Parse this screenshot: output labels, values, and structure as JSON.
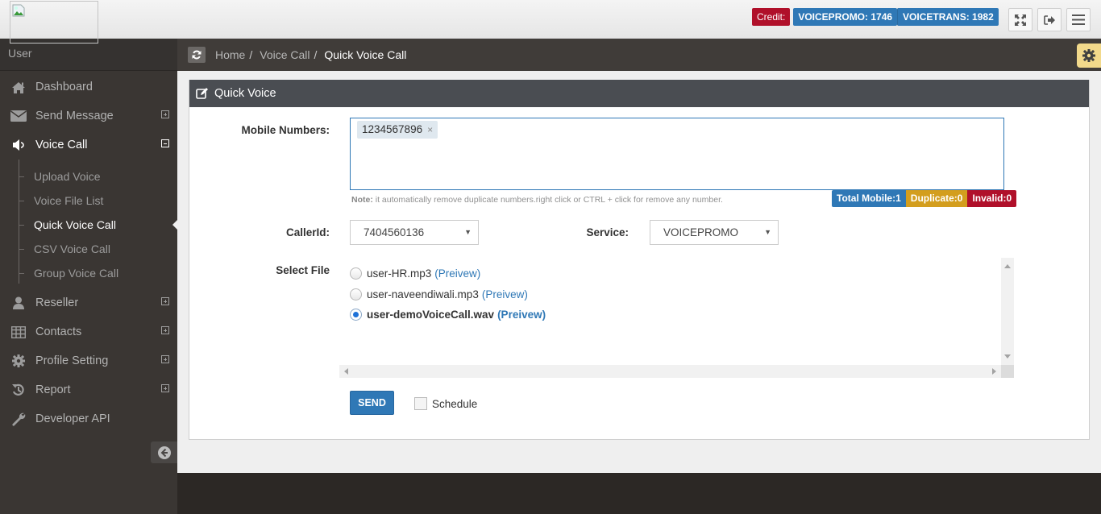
{
  "header": {
    "credit_label": "Credit:",
    "balances": [
      {
        "label": "VOICEPROMO: 1746"
      },
      {
        "label": "VOICETRANS: 1982"
      }
    ],
    "buttons": {
      "fullscreen": "fullscreen-icon",
      "logout": "logout-icon",
      "menu": "menu-icon"
    }
  },
  "sidebar": {
    "user_label": "User",
    "items": [
      {
        "label": "Dashboard",
        "icon": "home-icon"
      },
      {
        "label": "Send Message",
        "icon": "envelope-icon",
        "expand": "plus"
      },
      {
        "label": "Voice Call",
        "icon": "speaker-icon",
        "expand": "minus"
      },
      {
        "label": "Reseller",
        "icon": "user-icon",
        "expand": "plus"
      },
      {
        "label": "Contacts",
        "icon": "table-icon",
        "expand": "plus"
      },
      {
        "label": "Profile Setting",
        "icon": "gear-icon",
        "expand": "plus"
      },
      {
        "label": "Report",
        "icon": "history-icon",
        "expand": "plus"
      },
      {
        "label": "Developer API",
        "icon": "wrench-icon"
      }
    ],
    "voice_submenu": [
      {
        "label": "Upload Voice"
      },
      {
        "label": "Voice File List"
      },
      {
        "label": "Quick Voice Call"
      },
      {
        "label": "CSV Voice Call"
      },
      {
        "label": "Group Voice Call"
      }
    ]
  },
  "breadcrumb": {
    "items": [
      "Home",
      "Voice Call"
    ],
    "separator": "/",
    "current": "Quick Voice Call"
  },
  "panel": {
    "title": "Quick Voice",
    "mobile_label": "Mobile Numbers:",
    "mobile_tags": [
      "1234567896"
    ],
    "tag_remove": "×",
    "note_prefix": "Note:",
    "note_text": " it automatically remove duplicate numbers.right click or CTRL + click for remove any number.",
    "counts": {
      "total": "Total Mobile:1",
      "duplicate": "Duplicate:0",
      "invalid": "Invalid:0"
    },
    "callerid_label": "CallerId:",
    "callerid_value": "7404560136",
    "service_label": "Service:",
    "service_value": "VOICEPROMO",
    "select_file_label": "Select File",
    "files": [
      {
        "name": "user-HR.mp3",
        "preview": "(Preivew)",
        "checked": false
      },
      {
        "name": "user-naveendiwali.mp3",
        "preview": "(Preivew)",
        "checked": false
      },
      {
        "name": "user-demoVoiceCall.wav",
        "preview": "(Preivew)",
        "checked": true
      }
    ],
    "send_label": "SEND",
    "schedule_label": "Schedule"
  },
  "colors": {
    "primary": "#2f78b6",
    "danger": "#b0102a",
    "warning": "#d39e1e",
    "sidebar_bg": "#3a3633",
    "settings_btn": "#f2d98b"
  }
}
